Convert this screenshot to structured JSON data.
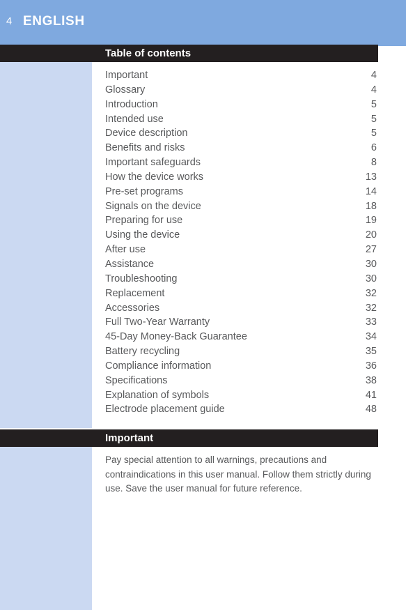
{
  "header": {
    "page_number": "4",
    "language": "ENGLISH",
    "background_color": "#7fa9df",
    "text_color": "#ffffff"
  },
  "sidebar": {
    "color": "#cbd9f2"
  },
  "sections": [
    {
      "id": "table-of-contents",
      "title": "Table of contents",
      "bar_color": "#231f20",
      "title_color": "#ffffff"
    },
    {
      "id": "important",
      "title": "Important",
      "bar_color": "#231f20",
      "title_color": "#ffffff"
    }
  ],
  "toc": {
    "text_color": "#58595b",
    "entries": [
      {
        "label": "Important",
        "page": "4"
      },
      {
        "label": "Glossary",
        "page": "4"
      },
      {
        "label": "Introduction",
        "page": "5"
      },
      {
        "label": "Intended use",
        "page": "5"
      },
      {
        "label": "Device description",
        "page": "5"
      },
      {
        "label": "Benefits and risks",
        "page": "6"
      },
      {
        "label": "Important safeguards",
        "page": "8"
      },
      {
        "label": "How the device works",
        "page": "13"
      },
      {
        "label": "Pre-set programs",
        "page": "14"
      },
      {
        "label": "Signals on the device",
        "page": "18"
      },
      {
        "label": "Preparing for use",
        "page": "19"
      },
      {
        "label": "Using the device",
        "page": "20"
      },
      {
        "label": "After use",
        "page": "27"
      },
      {
        "label": "Assistance",
        "page": "30"
      },
      {
        "label": "Troubleshooting",
        "page": "30"
      },
      {
        "label": "Replacement",
        "page": "32"
      },
      {
        "label": "Accessories",
        "page": "32"
      },
      {
        "label": "Full Two-Year Warranty",
        "page": "33"
      },
      {
        "label": "45-Day Money-Back Guarantee",
        "page": "34"
      },
      {
        "label": "Battery recycling",
        "page": "35"
      },
      {
        "label": "Compliance information",
        "page": "36"
      },
      {
        "label": "Specifications",
        "page": "38"
      },
      {
        "label": "Explanation of symbols",
        "page": "41"
      },
      {
        "label": "Electrode placement guide",
        "page": "48"
      }
    ]
  },
  "important": {
    "body": "Pay special attention to all warnings, precautions and contraindications in this user manual. Follow them strictly during use. Save the user manual for future reference."
  }
}
